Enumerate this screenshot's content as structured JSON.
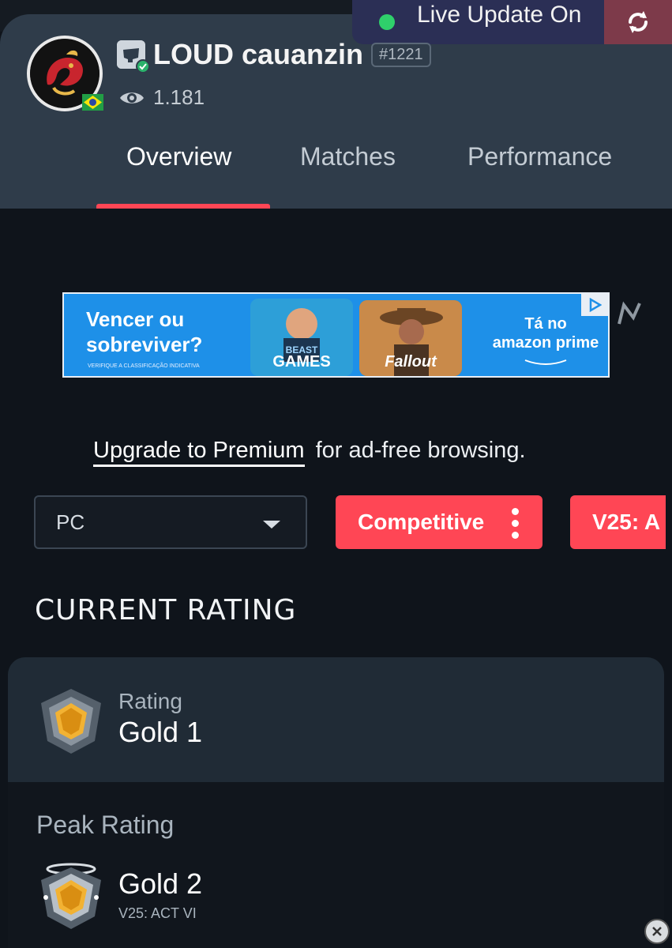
{
  "live_update": {
    "label": "Live Update On",
    "status_color": "#2fd06b",
    "refresh_icon": "refresh-icon"
  },
  "profile": {
    "name": "LOUD cauanzin",
    "tag": "#1221",
    "views": "1.181",
    "platform_icon": "riot-fist-icon",
    "verified_icon": "verified-check-icon",
    "flag_icon": "brazil-flag-icon",
    "view_icon": "eye-icon"
  },
  "tabs": [
    {
      "label": "Overview",
      "active": true
    },
    {
      "label": "Matches",
      "active": false
    },
    {
      "label": "Performance",
      "active": false
    }
  ],
  "ad": {
    "headline_line1": "Vencer ou",
    "headline_line2": "sobreviver?",
    "fineprint": "VERIFIQUE A CLASSIFICAÇÃO INDICATIVA",
    "card1_label": "GAMES",
    "card1_sub": "BEAST",
    "card2_label": "Fallout",
    "right_line1": "Tá no",
    "right_line2": "amazon prime"
  },
  "upgrade": {
    "link": "Upgrade to Premium",
    "rest": "for ad-free browsing."
  },
  "filters": {
    "platform": "PC",
    "mode": "Competitive",
    "season": "V25: A"
  },
  "section_title": "CURRENT RATING",
  "current": {
    "label": "Rating",
    "value": "Gold 1"
  },
  "peak": {
    "label": "Peak Rating",
    "value": "Gold 2",
    "season": "V25: ACT VI"
  },
  "colors": {
    "accent": "#ff4655",
    "header_bg": "#2f3c4a",
    "page_bg": "#0f141b",
    "gold": "#f2b233"
  }
}
